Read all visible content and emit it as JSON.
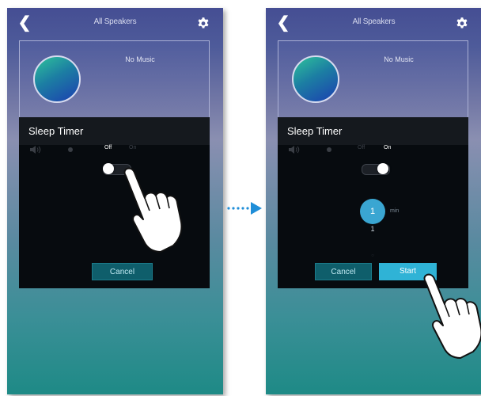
{
  "left_screen": {
    "header": {
      "title": "All Speakers",
      "back_icon": "chevron-left-icon",
      "settings_icon": "gear-icon"
    },
    "now_playing": {
      "status": "No Music"
    },
    "sleep_timer": {
      "title": "Sleep Timer",
      "toggle": {
        "off_label": "Off",
        "on_label": "On",
        "state": "off"
      },
      "cancel_label": "Cancel"
    }
  },
  "right_screen": {
    "header": {
      "title": "All Speakers",
      "back_icon": "chevron-left-icon",
      "settings_icon": "gear-icon"
    },
    "now_playing": {
      "status": "No Music"
    },
    "sleep_timer": {
      "title": "Sleep Timer",
      "toggle": {
        "off_label": "Off",
        "on_label": "On",
        "state": "on"
      },
      "picker": {
        "selected": "1",
        "unit": "min",
        "below": "1"
      },
      "cancel_label": "Cancel",
      "start_label": "Start"
    }
  },
  "colors": {
    "accent": "#2fb3d6",
    "panel": "#070b0f",
    "cancel_button": "#0f5e6b",
    "arrow": "#1f8ed8"
  }
}
